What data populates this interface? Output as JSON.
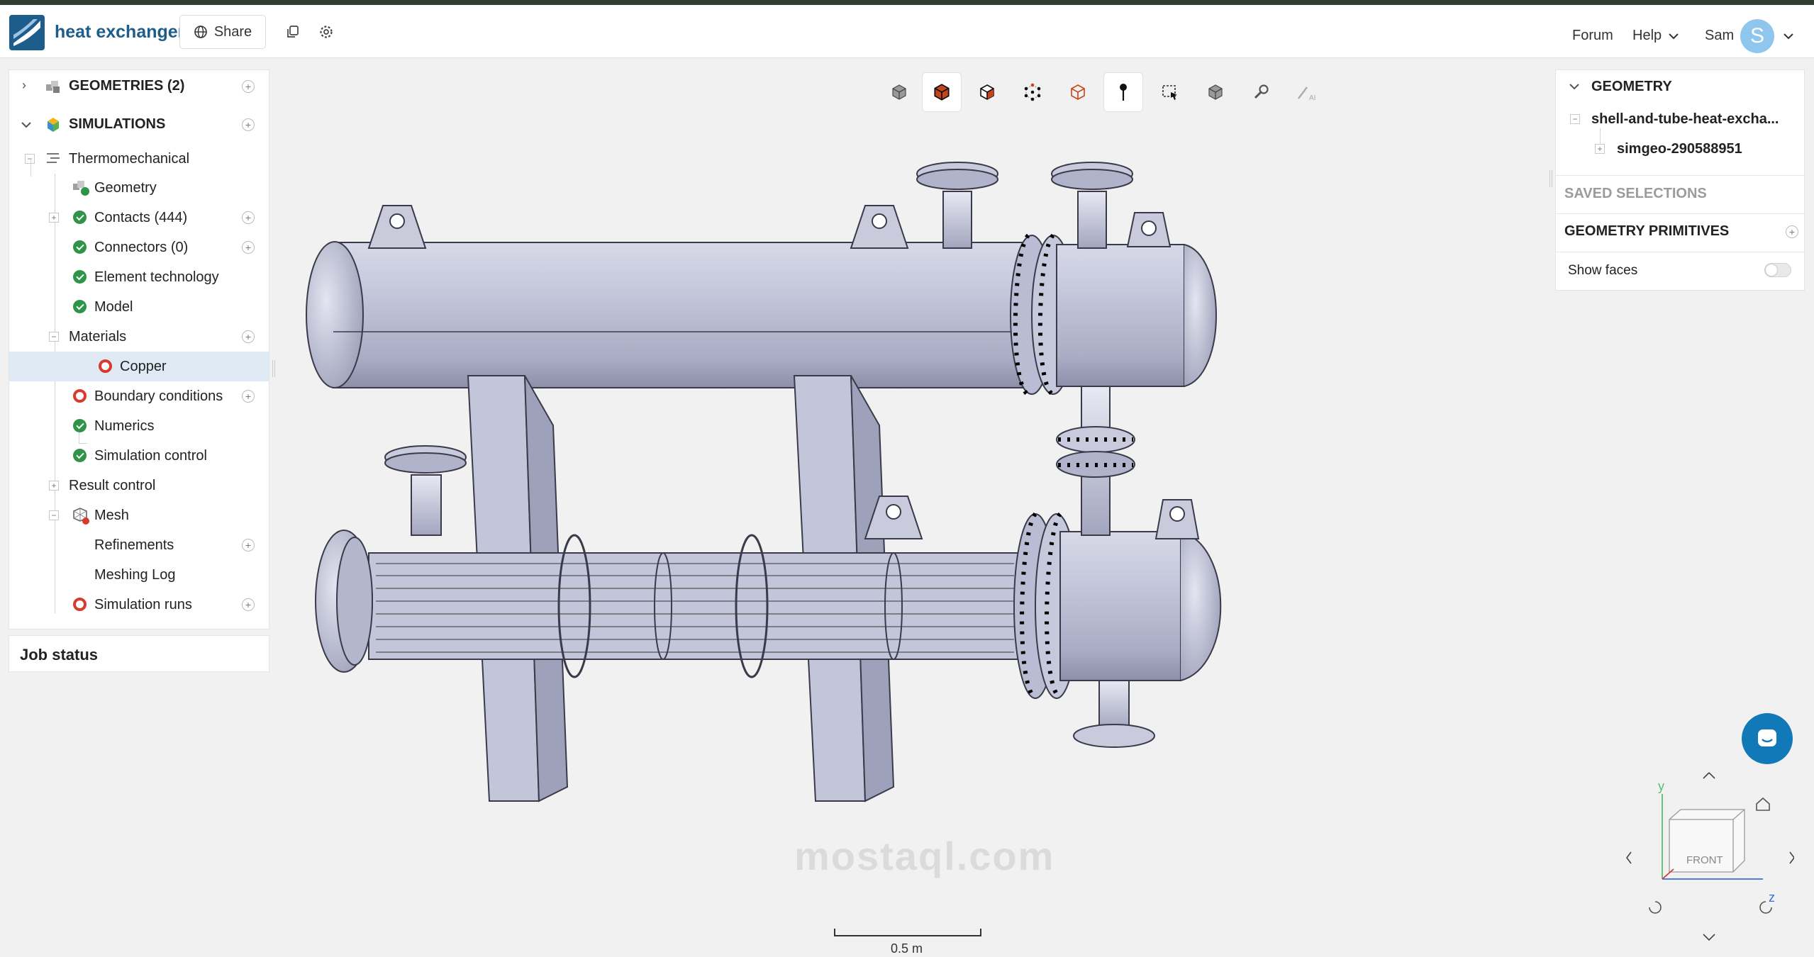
{
  "app": {
    "project_title": "heat exchanger",
    "share_label": "Share",
    "nav": {
      "forum": "Forum",
      "help": "Help",
      "user_name": "Sam",
      "avatar_initial": "S"
    },
    "brand_color": "#1d5d8c"
  },
  "tree": {
    "geometries_label": "GEOMETRIES (2)",
    "simulations_label": "SIMULATIONS",
    "simulation_name": "Thermomechanical",
    "items": [
      {
        "label": "Geometry",
        "status": "geometry-icon"
      },
      {
        "label": "Contacts (444)",
        "status": "ok"
      },
      {
        "label": "Connectors (0)",
        "status": "ok"
      },
      {
        "label": "Element technology",
        "status": "ok"
      },
      {
        "label": "Model",
        "status": "ok"
      },
      {
        "label": "Materials",
        "status": "none"
      },
      {
        "label": "Copper",
        "status": "error",
        "selected": true
      },
      {
        "label": "Boundary conditions",
        "status": "error"
      },
      {
        "label": "Numerics",
        "status": "ok"
      },
      {
        "label": "Simulation control",
        "status": "ok"
      },
      {
        "label": "Result control",
        "status": "none"
      },
      {
        "label": "Mesh",
        "status": "mesh-icon"
      },
      {
        "label": "Refinements",
        "status": "none"
      },
      {
        "label": "Meshing Log",
        "status": "none"
      },
      {
        "label": "Simulation runs",
        "status": "error"
      }
    ],
    "job_status_label": "Job status"
  },
  "toolbar": {
    "tools": [
      "view-cube-icon",
      "solid-select-icon",
      "face-select-icon",
      "vertex-select-icon",
      "edge-select-icon",
      "pin-icon",
      "box-select-icon",
      "hide-icon",
      "tools-icon",
      "ai-icon"
    ],
    "active_tool": "pin-icon"
  },
  "right_panel": {
    "geometry_header": "GEOMETRY",
    "geometry_file": "shell-and-tube-heat-excha...",
    "geometry_child": "simgeo-290588951",
    "saved_selections": "SAVED SELECTIONS",
    "geometry_primitives": "GEOMETRY PRIMITIVES",
    "show_faces_label": "Show faces",
    "show_faces_enabled": false
  },
  "viewport": {
    "scale_label": "0.5 m",
    "navcube_face": "FRONT",
    "axis_y": "y",
    "axis_z": "z",
    "watermark_text": "mostaql.com"
  }
}
